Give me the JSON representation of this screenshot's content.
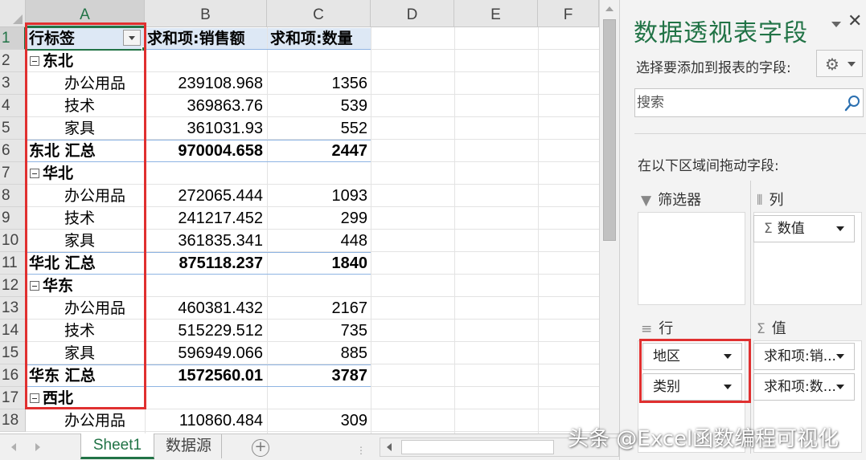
{
  "columns": [
    "A",
    "B",
    "C",
    "D",
    "E",
    "F"
  ],
  "rows": [
    "1",
    "2",
    "3",
    "4",
    "5",
    "6",
    "7",
    "8",
    "9",
    "10",
    "11",
    "12",
    "13",
    "14",
    "15",
    "16",
    "17",
    "18"
  ],
  "pivot": {
    "header": {
      "row_label": "行标签",
      "sum_sales": "求和项:销售额",
      "sum_qty": "求和项:数量"
    },
    "lines": [
      {
        "label": "东北",
        "sales": "",
        "qty": ""
      },
      {
        "label": "办公用品",
        "sales": "239108.968",
        "qty": "1356"
      },
      {
        "label": "技术",
        "sales": "369863.76",
        "qty": "539"
      },
      {
        "label": "家具",
        "sales": "361031.93",
        "qty": "552"
      },
      {
        "label": "东北 汇总",
        "sales": "970004.658",
        "qty": "2447"
      },
      {
        "label": "华北",
        "sales": "",
        "qty": ""
      },
      {
        "label": "办公用品",
        "sales": "272065.444",
        "qty": "1093"
      },
      {
        "label": "技术",
        "sales": "241217.452",
        "qty": "299"
      },
      {
        "label": "家具",
        "sales": "361835.341",
        "qty": "448"
      },
      {
        "label": "华北 汇总",
        "sales": "875118.237",
        "qty": "1840"
      },
      {
        "label": "华东",
        "sales": "",
        "qty": ""
      },
      {
        "label": "办公用品",
        "sales": "460381.432",
        "qty": "2167"
      },
      {
        "label": "技术",
        "sales": "515229.512",
        "qty": "735"
      },
      {
        "label": "家具",
        "sales": "596949.066",
        "qty": "885"
      },
      {
        "label": "华东 汇总",
        "sales": "1572560.01",
        "qty": "3787"
      },
      {
        "label": "西北",
        "sales": "",
        "qty": ""
      },
      {
        "label": "办公用品",
        "sales": "110860.484",
        "qty": "309"
      }
    ]
  },
  "tabs": {
    "active": "Sheet1",
    "other": "数据源",
    "add": "+"
  },
  "pane": {
    "title": "数据透视表字段",
    "choose_label": "选择要添加到报表的字段:",
    "search_placeholder": "搜索",
    "drag_label": "在以下区域间拖动字段:",
    "filters_label": "筛选器",
    "columns_label": "列",
    "rows_label": "行",
    "values_label": "值",
    "column_fields": [
      "数值"
    ],
    "row_fields": [
      "地区",
      "类别"
    ],
    "value_fields": [
      "求和项:销...",
      "求和项:数..."
    ]
  },
  "icons": [
    "filter-icon",
    "columns-icon",
    "rows-icon",
    "sigma-icon",
    "gear-icon",
    "search-icon",
    "close-icon",
    "add-sheet-icon"
  ],
  "colors": {
    "accent": "#217346",
    "highlight_box": "#e03030",
    "pivot_header_fill": "#dde8f5"
  },
  "watermark": "头条 @Excel函数编程可视化"
}
